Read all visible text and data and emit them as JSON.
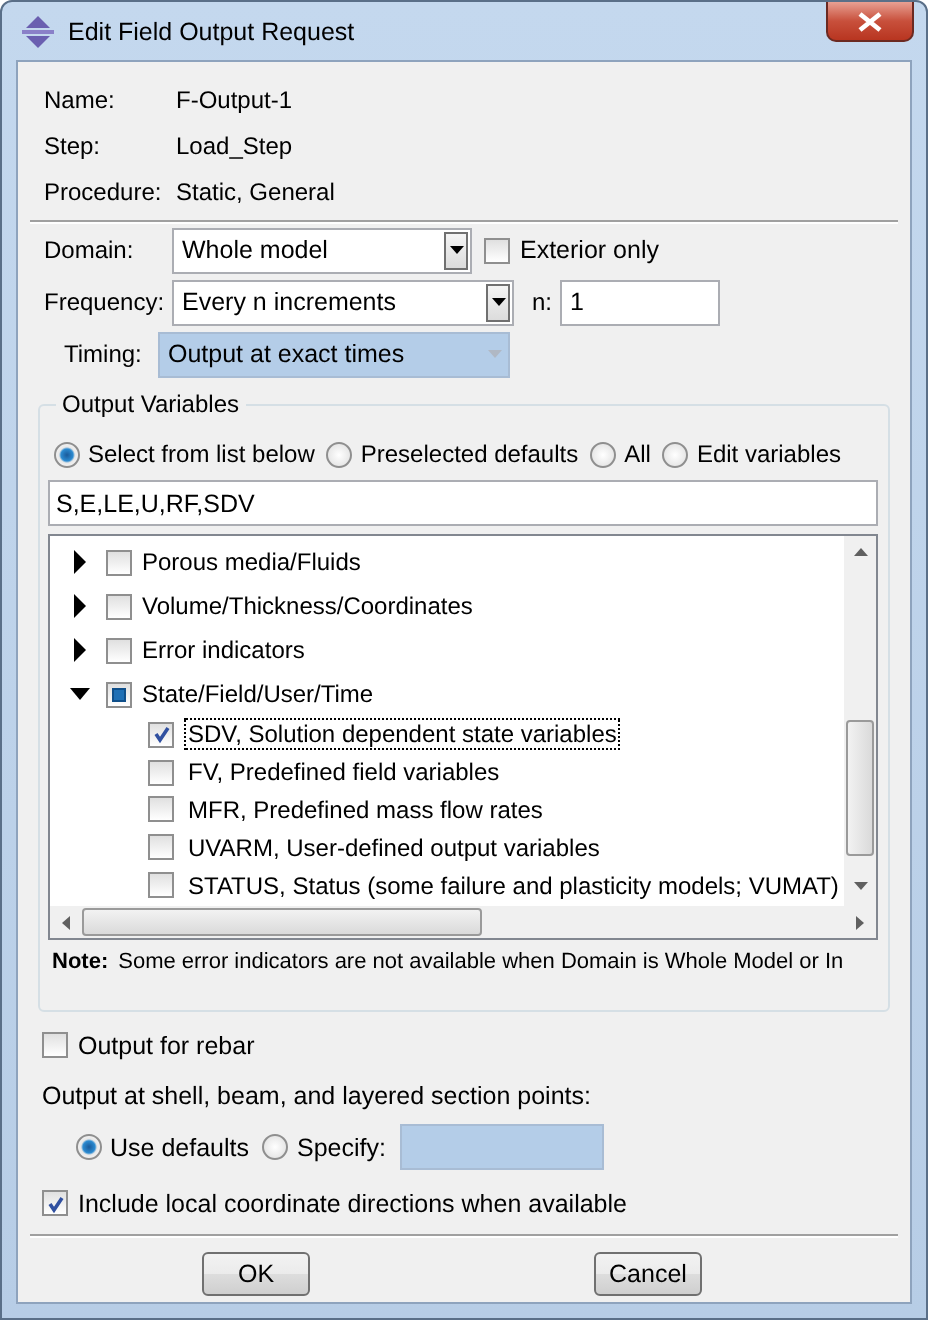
{
  "window": {
    "title": "Edit Field Output Request"
  },
  "info": [
    {
      "label": "Name:",
      "value": "F-Output-1"
    },
    {
      "label": "Step:",
      "value": "Load_Step"
    },
    {
      "label": "Procedure:",
      "value": "Static, General"
    }
  ],
  "domain": {
    "label": "Domain:",
    "value": "Whole model",
    "exterior_only": {
      "label": "Exterior only",
      "checked": false
    }
  },
  "frequency": {
    "label": "Frequency:",
    "value": "Every n increments",
    "n_label": "n:",
    "n_value": "1"
  },
  "timing": {
    "label": "Timing:",
    "value": "Output at exact times",
    "disabled": true
  },
  "output_variables": {
    "title": "Output Variables",
    "modes": [
      {
        "label": "Select from list below",
        "selected": true
      },
      {
        "label": "Preselected defaults",
        "selected": false
      },
      {
        "label": "All",
        "selected": false
      },
      {
        "label": "Edit variables",
        "selected": false
      }
    ],
    "variables_text": "S,E,LE,U,RF,SDV",
    "tree": [
      {
        "label": "Porous media/Fluids",
        "expanded": false,
        "partial": false
      },
      {
        "label": "Volume/Thickness/Coordinates",
        "expanded": false,
        "partial": false
      },
      {
        "label": "Error indicators",
        "expanded": false,
        "partial": false
      },
      {
        "label": "State/Field/User/Time",
        "expanded": true,
        "partial": true,
        "children": [
          {
            "label": "SDV, Solution dependent state variables",
            "checked": true,
            "focused": true
          },
          {
            "label": "FV, Predefined field variables",
            "checked": false,
            "focused": false
          },
          {
            "label": "MFR, Predefined mass flow rates",
            "checked": false,
            "focused": false
          },
          {
            "label": "UVARM, User-defined output variables",
            "checked": false,
            "focused": false
          },
          {
            "label": "STATUS, Status (some failure and plasticity models; VUMAT)",
            "checked": false,
            "focused": false
          }
        ]
      }
    ],
    "note_label": "Note:",
    "note": "Some error indicators are not available when Domain is Whole Model or In"
  },
  "rebar": {
    "label": "Output for rebar",
    "checked": false
  },
  "section_points": {
    "label": "Output at shell, beam, and layered section points:",
    "options": [
      {
        "label": "Use defaults",
        "selected": true
      },
      {
        "label": "Specify:",
        "selected": false
      }
    ]
  },
  "local_coords": {
    "label": "Include local coordinate directions when available",
    "checked": true
  },
  "buttons": [
    "OK",
    "Cancel"
  ]
}
